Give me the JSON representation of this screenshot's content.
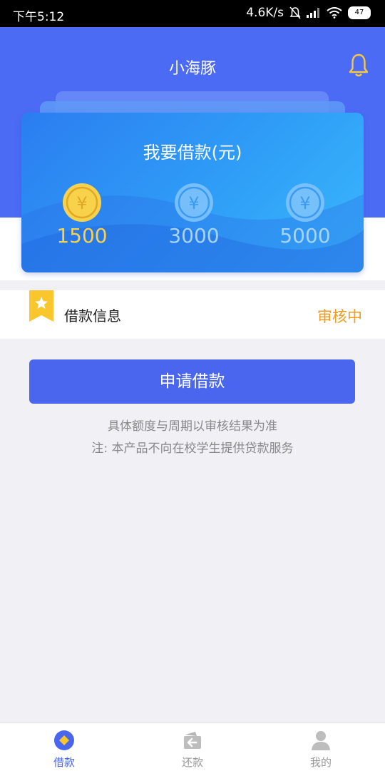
{
  "status_bar": {
    "time": "下午5:12",
    "network_speed": "4.6K/s",
    "battery": "47",
    "icons": [
      "mute-bell-icon",
      "signal-icon",
      "wifi-icon",
      "battery-icon"
    ]
  },
  "header": {
    "title": "小海豚",
    "bell_icon": "bell-icon",
    "background_color": "#4c6bf5"
  },
  "loan_card": {
    "title": "我要借款(元)",
    "amounts": [
      {
        "value": "1500",
        "selected": true
      },
      {
        "value": "3000",
        "selected": false
      },
      {
        "value": "5000",
        "selected": false
      }
    ],
    "coin_icon": "yuan-coin-icon",
    "selected_color": "#f9d24c"
  },
  "info": {
    "label": "借款信息",
    "status": "审核中",
    "badge_icon": "star-bookmark-icon",
    "status_color": "#f09b1b"
  },
  "apply_button": {
    "label": "申请借款",
    "color": "#4a66ee"
  },
  "notes": {
    "line1": "具体额度与周期以审核结果为准",
    "line2": "注: 本产品不向在校学生提供贷款服务"
  },
  "tabs": [
    {
      "label": "借款",
      "icon": "loan-icon",
      "active": true
    },
    {
      "label": "还款",
      "icon": "repay-icon",
      "active": false
    },
    {
      "label": "我的",
      "icon": "user-icon",
      "active": false
    }
  ]
}
